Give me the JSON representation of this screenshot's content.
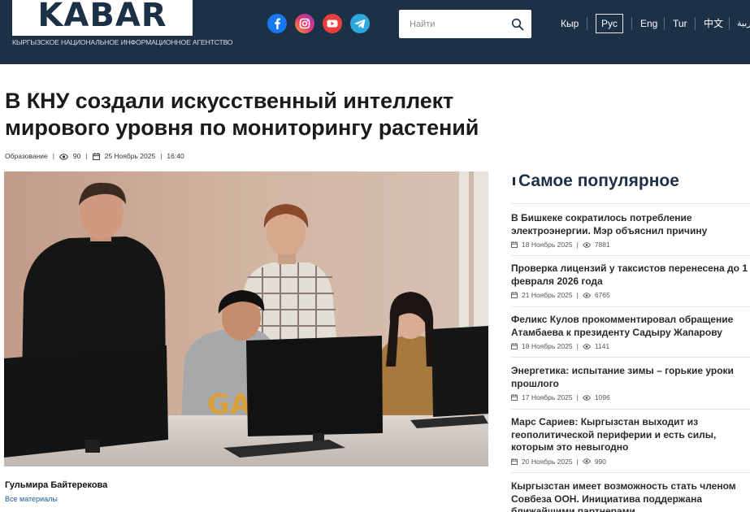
{
  "header": {
    "logo": "KABAR",
    "tagline": "КЫРГЫЗСКОЕ НАЦИОНАЛЬНОЕ ИНФОРМАЦИОННОЕ АГЕНТСТВО",
    "social": [
      "facebook-icon",
      "instagram-icon",
      "youtube-icon",
      "telegram-icon"
    ],
    "search": {
      "placeholder": "Найти"
    },
    "languages": [
      "Кыр",
      "Рус",
      "Eng",
      "Tur",
      "中文",
      "عربية"
    ],
    "active_language": "Рус"
  },
  "article": {
    "title": "В КНУ создали искусственный интеллект мирового уровня по мониторингу растений",
    "category": "Образование",
    "views": "90",
    "date": "25 Ноябрь 2025",
    "time": "16:40",
    "author": "Гульмира Байтерекова",
    "all_posts": "Все материалы"
  },
  "sidebar": {
    "title": "Самое популярное",
    "items": [
      {
        "title": "В Бишкеке сократилось потребление электроэнергии. Мэр объяснил причину",
        "date": "18 Ноябрь 2025",
        "views": "7881"
      },
      {
        "title": "Проверка лицензий у таксистов перенесена до 1 февраля 2026 года",
        "date": "21 Ноябрь 2025",
        "views": "6765"
      },
      {
        "title": "Феликс Кулов прокомментировал обращение Атамбаева к президенту Садыру Жапарову",
        "date": "18 Ноябрь 2025",
        "views": "1141"
      },
      {
        "title": "Энергетика: испытание зимы – горькие уроки прошлого",
        "date": "17 Ноябрь 2025",
        "views": "1096"
      },
      {
        "title": "Марс Сариев: Кыргызстан выходит из геополитической периферии и есть силы, которым это невыгодно",
        "date": "20 Ноябрь 2025",
        "views": "990"
      },
      {
        "title": "Кыргызстан имеет возможность стать членом Совбеза ООН. Инициатива поддержана ближайшими партнерами",
        "date": "",
        "views": ""
      }
    ]
  },
  "colors": {
    "header_bg": "#1c3046",
    "accent": "#1c3046"
  }
}
